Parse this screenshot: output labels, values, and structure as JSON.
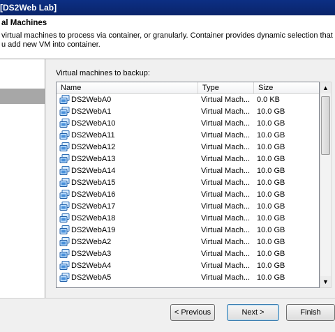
{
  "window": {
    "title": "[DS2Web Lab]"
  },
  "header": {
    "title": "al Machines",
    "desc_line1": "virtual machines to process via container, or granularly. Container provides dynamic selection that auto",
    "desc_line2": "u add new VM into container."
  },
  "list": {
    "label": "Virtual machines to backup:",
    "columns": {
      "name": "Name",
      "type": "Type",
      "size": "Size"
    },
    "rows": [
      {
        "name": "DS2WebA0",
        "type": "Virtual Mach...",
        "size": "0.0 KB"
      },
      {
        "name": "DS2WebA1",
        "type": "Virtual Mach...",
        "size": "10.0 GB"
      },
      {
        "name": "DS2WebA10",
        "type": "Virtual Mach...",
        "size": "10.0 GB"
      },
      {
        "name": "DS2WebA11",
        "type": "Virtual Mach...",
        "size": "10.0 GB"
      },
      {
        "name": "DS2WebA12",
        "type": "Virtual Mach...",
        "size": "10.0 GB"
      },
      {
        "name": "DS2WebA13",
        "type": "Virtual Mach...",
        "size": "10.0 GB"
      },
      {
        "name": "DS2WebA14",
        "type": "Virtual Mach...",
        "size": "10.0 GB"
      },
      {
        "name": "DS2WebA15",
        "type": "Virtual Mach...",
        "size": "10.0 GB"
      },
      {
        "name": "DS2WebA16",
        "type": "Virtual Mach...",
        "size": "10.0 GB"
      },
      {
        "name": "DS2WebA17",
        "type": "Virtual Mach...",
        "size": "10.0 GB"
      },
      {
        "name": "DS2WebA18",
        "type": "Virtual Mach...",
        "size": "10.0 GB"
      },
      {
        "name": "DS2WebA19",
        "type": "Virtual Mach...",
        "size": "10.0 GB"
      },
      {
        "name": "DS2WebA2",
        "type": "Virtual Mach...",
        "size": "10.0 GB"
      },
      {
        "name": "DS2WebA3",
        "type": "Virtual Mach...",
        "size": "10.0 GB"
      },
      {
        "name": "DS2WebA4",
        "type": "Virtual Mach...",
        "size": "10.0 GB"
      },
      {
        "name": "DS2WebA5",
        "type": "Virtual Mach...",
        "size": "10.0 GB"
      }
    ],
    "icon": "vm-icon"
  },
  "buttons": {
    "previous": "< Previous",
    "next": "Next >",
    "finish": "Finish"
  },
  "colors": {
    "titlebar": "#0a246a",
    "sidebar_selection": "#a7a7a7",
    "default_button_border": "#3c7fb1"
  }
}
